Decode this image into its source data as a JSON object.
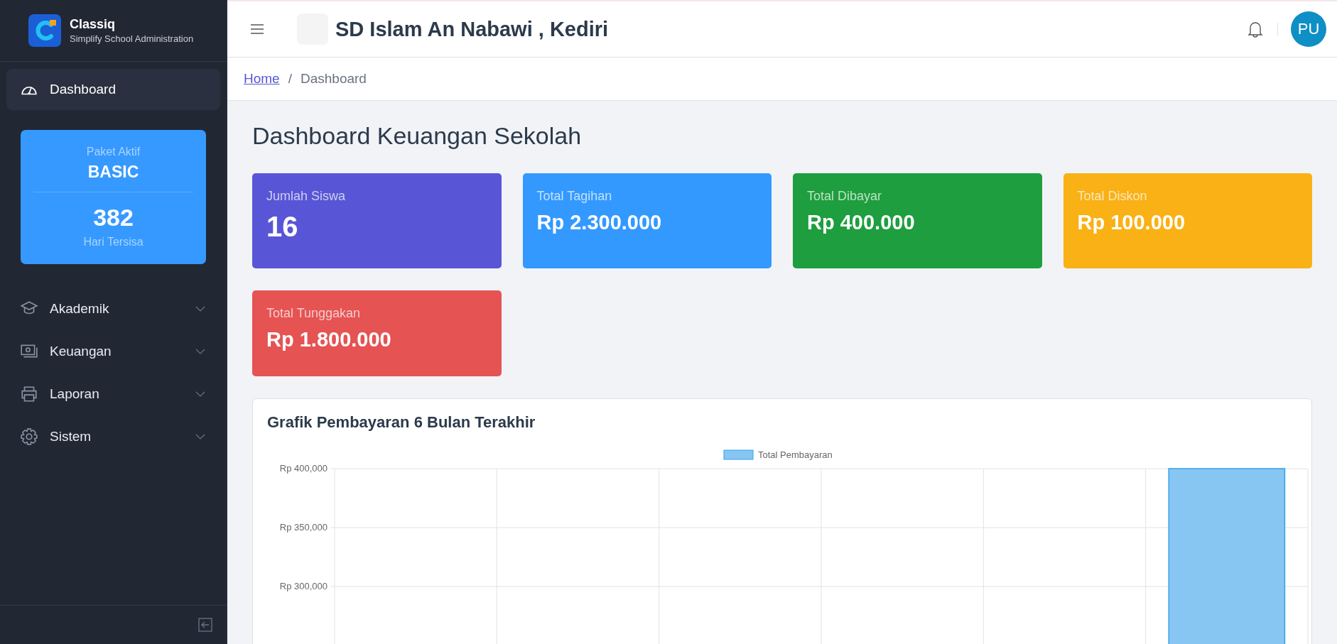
{
  "sidebar": {
    "brand": {
      "name": "Classiq",
      "tagline": "Simplify School Administration"
    },
    "menu_top": [
      {
        "label": "Dashboard",
        "kind": "link",
        "selected": true
      }
    ],
    "package": {
      "caption": "Paket Aktif",
      "plan": "BASIC",
      "days": "382",
      "days_label": "Hari Tersisa"
    },
    "menu": [
      {
        "label": "Akademik",
        "kind": "group",
        "selected": false,
        "expanded": false
      },
      {
        "label": "Keuangan",
        "kind": "group",
        "selected": false,
        "expanded": false
      },
      {
        "label": "Laporan",
        "kind": "group",
        "selected": false,
        "expanded": false
      },
      {
        "label": "Sistem",
        "kind": "group",
        "selected": false,
        "expanded": false
      }
    ]
  },
  "header": {
    "title": "SD Islam An Nabawi , Kediri",
    "avatar": "PU"
  },
  "breadcrumb": [
    {
      "label": "Home",
      "kind": "link"
    },
    {
      "label": "/",
      "kind": "separator"
    },
    {
      "label": "Dashboard",
      "kind": "current"
    }
  ],
  "page_title": "Dashboard Keuangan Sekolah",
  "stats": [
    {
      "label": "Jumlah Siswa",
      "value": "16",
      "color": "#5856d6",
      "kind": "count"
    },
    {
      "label": "Total Tagihan",
      "value": "Rp 2.300.000",
      "color": "#3399ff",
      "kind": "money"
    },
    {
      "label": "Total Dibayar",
      "value": "Rp 400.000",
      "color": "#1e9e3e",
      "kind": "money"
    },
    {
      "label": "Total Diskon",
      "value": "Rp 100.000",
      "color": "#f9b115",
      "kind": "money"
    },
    {
      "label": "Total Tunggakan",
      "value": "Rp 1.800.000",
      "color": "#e55353",
      "kind": "money"
    }
  ],
  "chart_card": {
    "title": "Grafik Pembayaran 6 Bulan Terakhir",
    "legend": "Total Pembayaran",
    "y_axis_labels": [
      "Rp 400,000",
      "Rp 350,000",
      "Rp 300,000"
    ]
  }
}
